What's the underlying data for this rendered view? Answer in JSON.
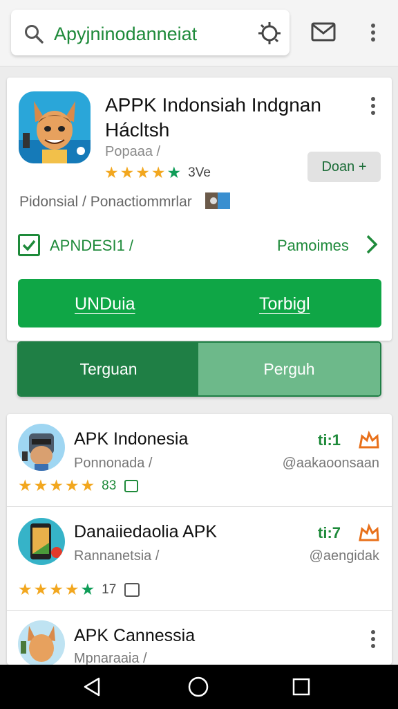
{
  "search": {
    "query": "Apyjninodanneiat"
  },
  "featured": {
    "title": "APPK Indonsiah Indgnan Hácltsh",
    "developer": "Popaaa /",
    "rating_text": "3Ve",
    "download_pill": "Doan +",
    "meta": "Pidonsial / Ponactiommrlar",
    "checkbox_label": "APNDESI1 /",
    "more_label": "Pamoimes",
    "install_left": "UNDuia",
    "install_right": "Torbigl"
  },
  "segmented": {
    "left": "Terguan",
    "right": "Perguh"
  },
  "apps": [
    {
      "title": "APK Indonesia",
      "subtitle": "Ponnonada /",
      "handle": "@aakaoonsaan",
      "size": "ti:1",
      "rating_text": "83"
    },
    {
      "title": "Danaiiedaolia APK",
      "subtitle": "Rannanetsia /",
      "handle": "@aengidak",
      "size": "ti:7",
      "rating_text": "17"
    },
    {
      "title": "APK Cannessia",
      "subtitle": "Mpnaraaia /"
    }
  ],
  "colors": {
    "accent": "#0fa646",
    "accent_dark": "#1f7f45",
    "star": "#f2a71f",
    "star_green": "#0f9d58",
    "badge": "#e8701a"
  },
  "icons": [
    "search-icon",
    "lens-icon",
    "mail-icon",
    "more-vert-icon",
    "check-icon",
    "chevron-right-icon",
    "back-icon",
    "home-icon",
    "recents-icon"
  ]
}
